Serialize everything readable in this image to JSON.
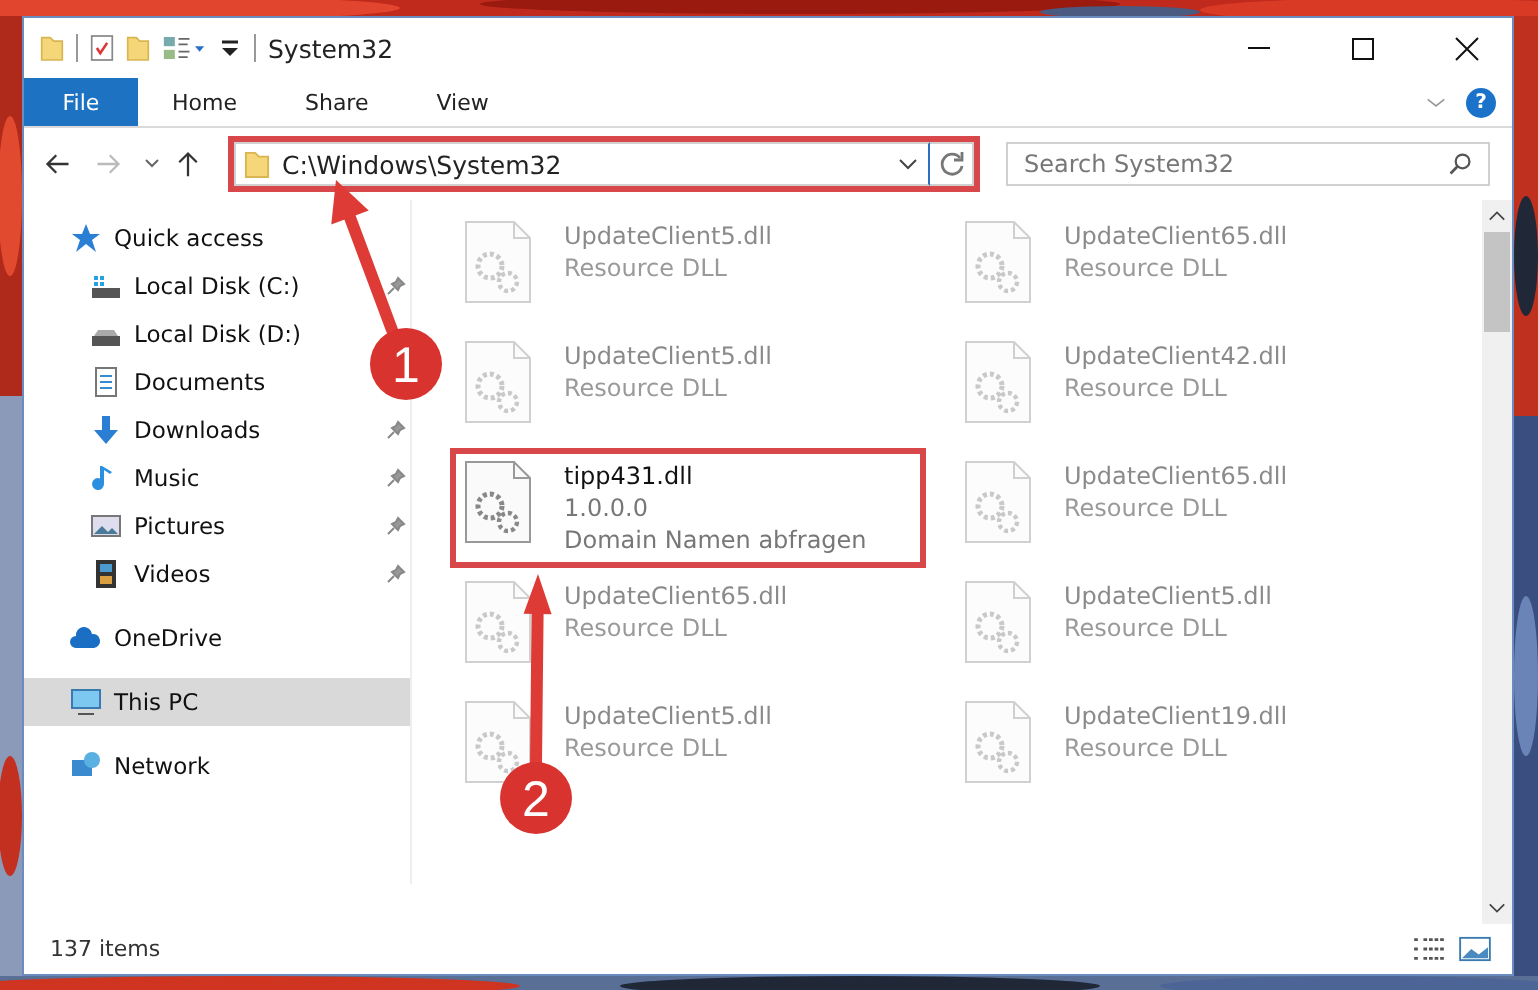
{
  "window": {
    "title": "System32"
  },
  "ribbon": {
    "tabs": [
      {
        "label": "File",
        "selected": true
      },
      {
        "label": "Home",
        "selected": false
      },
      {
        "label": "Share",
        "selected": false
      },
      {
        "label": "View",
        "selected": false
      }
    ],
    "help": "?"
  },
  "address": {
    "path": "C:\\Windows\\System32",
    "highlighted": true
  },
  "search": {
    "placeholder": "Search System32"
  },
  "sidebar": {
    "items": [
      {
        "label": "Quick access",
        "kind": "star",
        "selected": false,
        "children": [
          {
            "label": "Local Disk (C:)",
            "kind": "systemdrive",
            "pinned": true,
            "selected": false
          },
          {
            "label": "Local Disk (D:)",
            "kind": "drive",
            "pinned": false,
            "selected": false
          },
          {
            "label": "Documents",
            "kind": "document",
            "pinned": false,
            "selected": false
          },
          {
            "label": "Downloads",
            "kind": "download",
            "pinned": true,
            "selected": false
          },
          {
            "label": "Music",
            "kind": "music",
            "pinned": true,
            "selected": false
          },
          {
            "label": "Pictures",
            "kind": "pictures",
            "pinned": true,
            "selected": false
          },
          {
            "label": "Videos",
            "kind": "videos",
            "pinned": true,
            "selected": false
          }
        ]
      },
      {
        "label": "OneDrive",
        "kind": "cloud",
        "selected": false
      },
      {
        "label": "This PC",
        "kind": "pc",
        "selected": true
      },
      {
        "label": "Network",
        "kind": "network",
        "selected": false
      }
    ]
  },
  "files": [
    {
      "name": "UpdateClient5.dll",
      "details": [
        "Resource DLL"
      ],
      "faded": true,
      "highlighted": false
    },
    {
      "name": "UpdateClient65.dll",
      "details": [
        "Resource DLL"
      ],
      "faded": true,
      "highlighted": false
    },
    {
      "name": "UpdateClient5.dll",
      "details": [
        "Resource DLL"
      ],
      "faded": true,
      "highlighted": false
    },
    {
      "name": "UpdateClient42.dll",
      "details": [
        "Resource DLL"
      ],
      "faded": true,
      "highlighted": false
    },
    {
      "name": "tipp431.dll",
      "details": [
        "1.0.0.0",
        "Domain Namen abfragen"
      ],
      "faded": false,
      "highlighted": true
    },
    {
      "name": "UpdateClient65.dll",
      "details": [
        "Resource DLL"
      ],
      "faded": true,
      "highlighted": false
    },
    {
      "name": "UpdateClient65.dll",
      "details": [
        "Resource DLL"
      ],
      "faded": true,
      "highlighted": false
    },
    {
      "name": "UpdateClient5.dll",
      "details": [
        "Resource DLL"
      ],
      "faded": true,
      "highlighted": false
    },
    {
      "name": "UpdateClient5.dll",
      "details": [
        "Resource DLL"
      ],
      "faded": true,
      "highlighted": false
    },
    {
      "name": "UpdateClient19.dll",
      "details": [
        "Resource DLL"
      ],
      "faded": true,
      "highlighted": false
    }
  ],
  "status_bar": {
    "count": "137 items"
  },
  "callouts": [
    {
      "number": "1"
    },
    {
      "number": "2"
    }
  ]
}
